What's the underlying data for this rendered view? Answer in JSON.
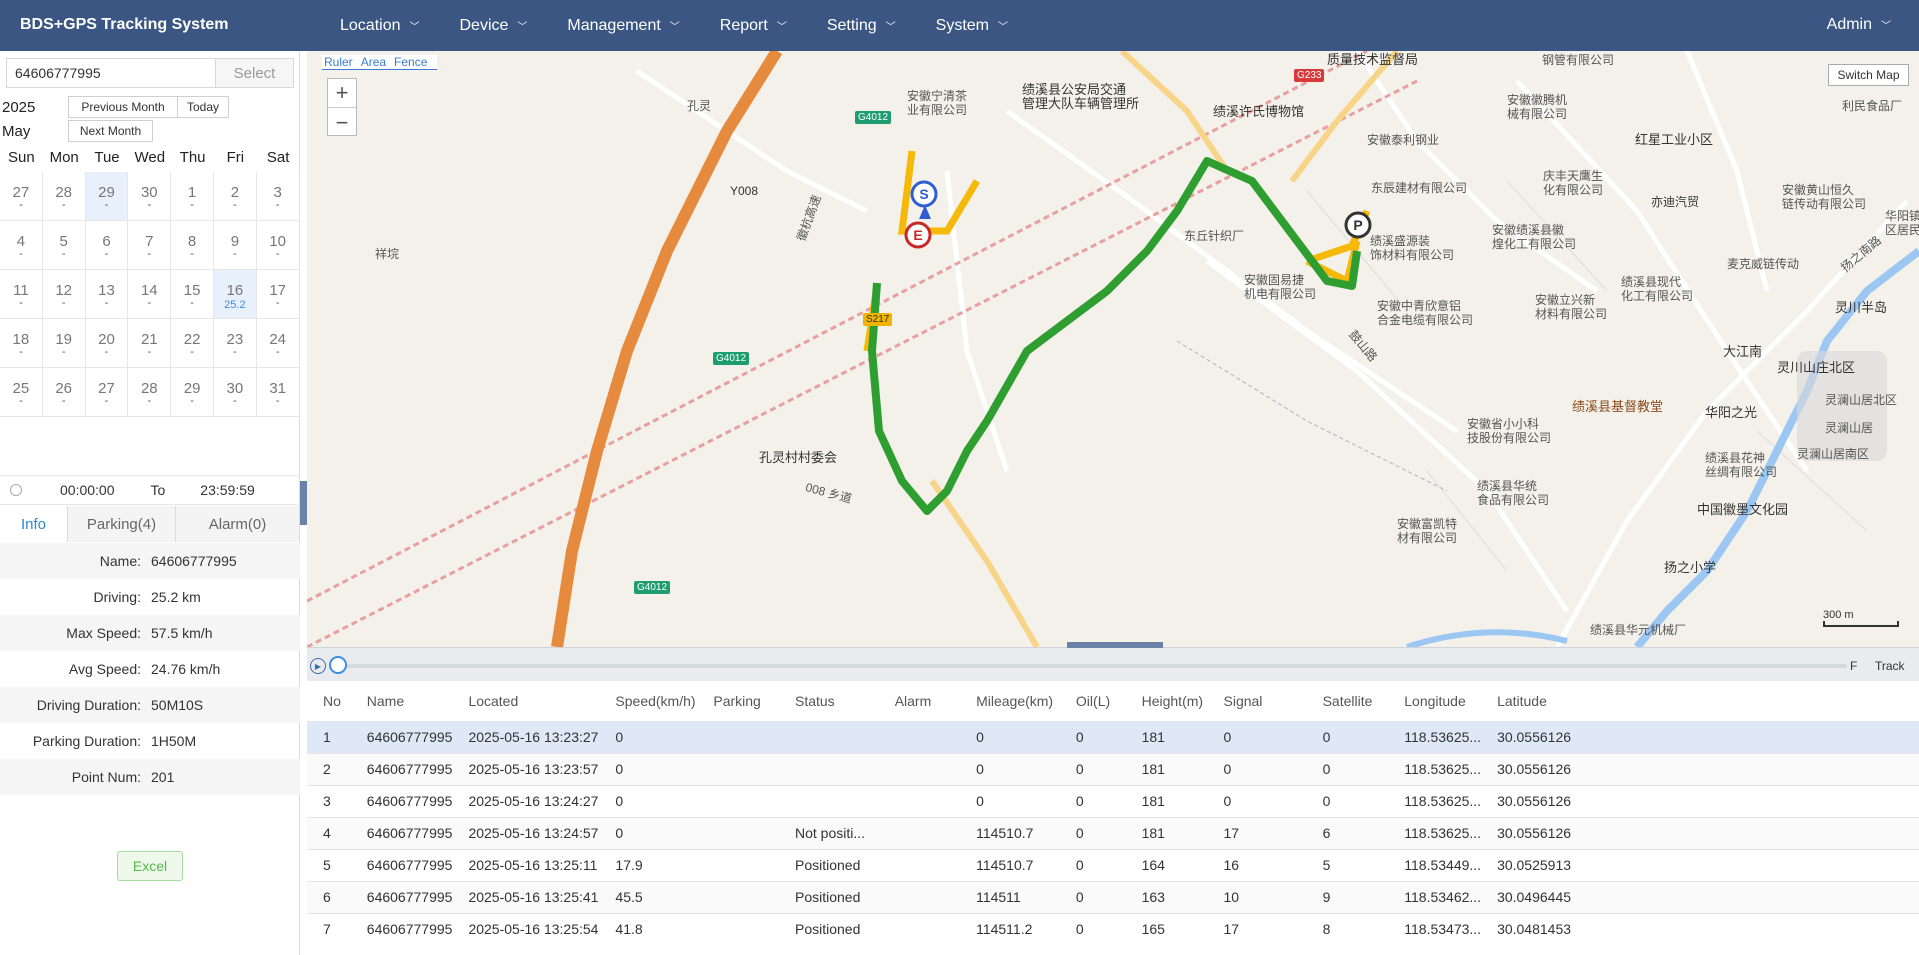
{
  "app": {
    "title": "BDS+GPS Tracking System",
    "user": "Admin"
  },
  "nav": {
    "items": [
      {
        "label": "Location"
      },
      {
        "label": "Device"
      },
      {
        "label": "Management"
      },
      {
        "label": "Report"
      },
      {
        "label": "Setting"
      },
      {
        "label": "System"
      }
    ]
  },
  "search": {
    "device_value": "64606777995",
    "select_label": "Select"
  },
  "calendar": {
    "year": "2025",
    "month": "May",
    "prev_label": "Previous Month",
    "today_label": "Today",
    "next_label": "Next Month",
    "weekdays": [
      "Sun",
      "Mon",
      "Tue",
      "Wed",
      "Thu",
      "Fri",
      "Sat"
    ],
    "weeks": [
      [
        {
          "d": "27"
        },
        {
          "d": "28"
        },
        {
          "d": "29",
          "hl": true
        },
        {
          "d": "30"
        },
        {
          "d": "1"
        },
        {
          "d": "2"
        },
        {
          "d": "3"
        }
      ],
      [
        {
          "d": "4"
        },
        {
          "d": "5"
        },
        {
          "d": "6"
        },
        {
          "d": "7"
        },
        {
          "d": "8"
        },
        {
          "d": "9"
        },
        {
          "d": "10"
        }
      ],
      [
        {
          "d": "11"
        },
        {
          "d": "12"
        },
        {
          "d": "13"
        },
        {
          "d": "14"
        },
        {
          "d": "15"
        },
        {
          "d": "16",
          "hl": true,
          "mileage": "25.2"
        },
        {
          "d": "17"
        }
      ],
      [
        {
          "d": "18"
        },
        {
          "d": "19"
        },
        {
          "d": "20"
        },
        {
          "d": "21"
        },
        {
          "d": "22"
        },
        {
          "d": "23"
        },
        {
          "d": "24"
        }
      ],
      [
        {
          "d": "25"
        },
        {
          "d": "26"
        },
        {
          "d": "27"
        },
        {
          "d": "28"
        },
        {
          "d": "29"
        },
        {
          "d": "30"
        },
        {
          "d": "31"
        }
      ]
    ]
  },
  "time_range": {
    "start": "00:00:00",
    "to_label": "To",
    "end": "23:59:59"
  },
  "tabs": [
    {
      "label": "Info"
    },
    {
      "label": "Parking(4)"
    },
    {
      "label": "Alarm(0)"
    }
  ],
  "info": [
    {
      "label": "Name:",
      "value": "64606777995"
    },
    {
      "label": "Driving:",
      "value": "25.2 km"
    },
    {
      "label": "Max Speed:",
      "value": "57.5 km/h"
    },
    {
      "label": "Avg Speed:",
      "value": "24.76 km/h"
    },
    {
      "label": "Driving Duration:",
      "value": "50M10S"
    },
    {
      "label": "Parking Duration:",
      "value": "1H50M"
    },
    {
      "label": "Point Num:",
      "value": "201"
    }
  ],
  "excel_label": "Excel",
  "map": {
    "tools": [
      "Ruler",
      "Area",
      "Fence"
    ],
    "switch_label": "Switch Map",
    "scale_label": "300 m",
    "markers": {
      "start": "S",
      "end": "E",
      "parking": "P"
    },
    "labels": [
      "孔灵",
      "安徽宁清茶\n业有限公司",
      "绩溪县公安局交通\n管理大队车辆管理所",
      "质量技术监督局",
      "钢管有限公司",
      "安徽徽腾机\n械有限公司",
      "利民食品厂",
      "绩溪许氏博物馆",
      "安徽泰利钢业",
      "红星工业小区",
      "东辰建材有限公司",
      "庆丰天鹰生\n化有限公司",
      "亦迪汽贸",
      "安徽黄山恒久\n链传动有限公司",
      "东丘针织厂",
      "绩溪盛源装\n饰材料有限公司",
      "安徽绩溪县徽\n煌化工有限公司",
      "麦克威链传动",
      "安徽固易捷\n机电有限公司",
      "安徽中青欣意铝\n合金电缆有限公司",
      "安徽立兴新\n材料有限公司",
      "绩溪县现代\n化工有限公司",
      "灵川半岛",
      "大江南",
      "灵川山庄北区",
      "祥垸",
      "孔灵村村委会",
      "安徽省小小科\n技股份有限公司",
      "绩溪县基督教堂",
      "华阳之光",
      "灵澜山居北区",
      "灵澜山居",
      "绩溪县花神\n丝绸有限公司",
      "灵澜山居南区",
      "绩溪县华统\n食品有限公司",
      "中国徽墨文化园",
      "安徽富凯特\n材有限公司",
      "扬之小学",
      "绩溪县华元机械厂",
      "华阳镇\n区居民",
      "扬之南路",
      "008 乡道",
      "徽杭高速",
      "鼓山路"
    ],
    "roads": [
      "G4012",
      "G233",
      "Y008",
      "S217"
    ]
  },
  "playback": {
    "speed_label": "F",
    "track_label": "Track"
  },
  "table": {
    "headers": [
      "No",
      "Name",
      "Located",
      "Speed(km/h)",
      "Parking",
      "Status",
      "Alarm",
      "Mileage(km)",
      "Oil(L)",
      "Height(m)",
      "Signal",
      "Satellite",
      "Longitude",
      "Latitude"
    ],
    "rows": [
      [
        "1",
        "64606777995",
        "2025-05-16 13:23:27",
        "0",
        "",
        "",
        "",
        "0",
        "0",
        "181",
        "0",
        "0",
        "118.53625...",
        "30.0556126"
      ],
      [
        "2",
        "64606777995",
        "2025-05-16 13:23:57",
        "0",
        "",
        "",
        "",
        "0",
        "0",
        "181",
        "0",
        "0",
        "118.53625...",
        "30.0556126"
      ],
      [
        "3",
        "64606777995",
        "2025-05-16 13:24:27",
        "0",
        "",
        "",
        "",
        "0",
        "0",
        "181",
        "0",
        "0",
        "118.53625...",
        "30.0556126"
      ],
      [
        "4",
        "64606777995",
        "2025-05-16 13:24:57",
        "0",
        "",
        "Not positi...",
        "",
        "114510.7",
        "0",
        "181",
        "17",
        "6",
        "118.53625...",
        "30.0556126"
      ],
      [
        "5",
        "64606777995",
        "2025-05-16 13:25:11",
        "17.9",
        "",
        "Positioned",
        "",
        "114510.7",
        "0",
        "164",
        "16",
        "5",
        "118.53449...",
        "30.0525913"
      ],
      [
        "6",
        "64606777995",
        "2025-05-16 13:25:41",
        "45.5",
        "",
        "Positioned",
        "",
        "114511",
        "0",
        "163",
        "10",
        "9",
        "118.53462...",
        "30.0496445"
      ],
      [
        "7",
        "64606777995",
        "2025-05-16 13:25:54",
        "41.8",
        "",
        "Positioned",
        "",
        "114511.2",
        "0",
        "165",
        "17",
        "8",
        "118.53473...",
        "30.0481453"
      ]
    ]
  }
}
